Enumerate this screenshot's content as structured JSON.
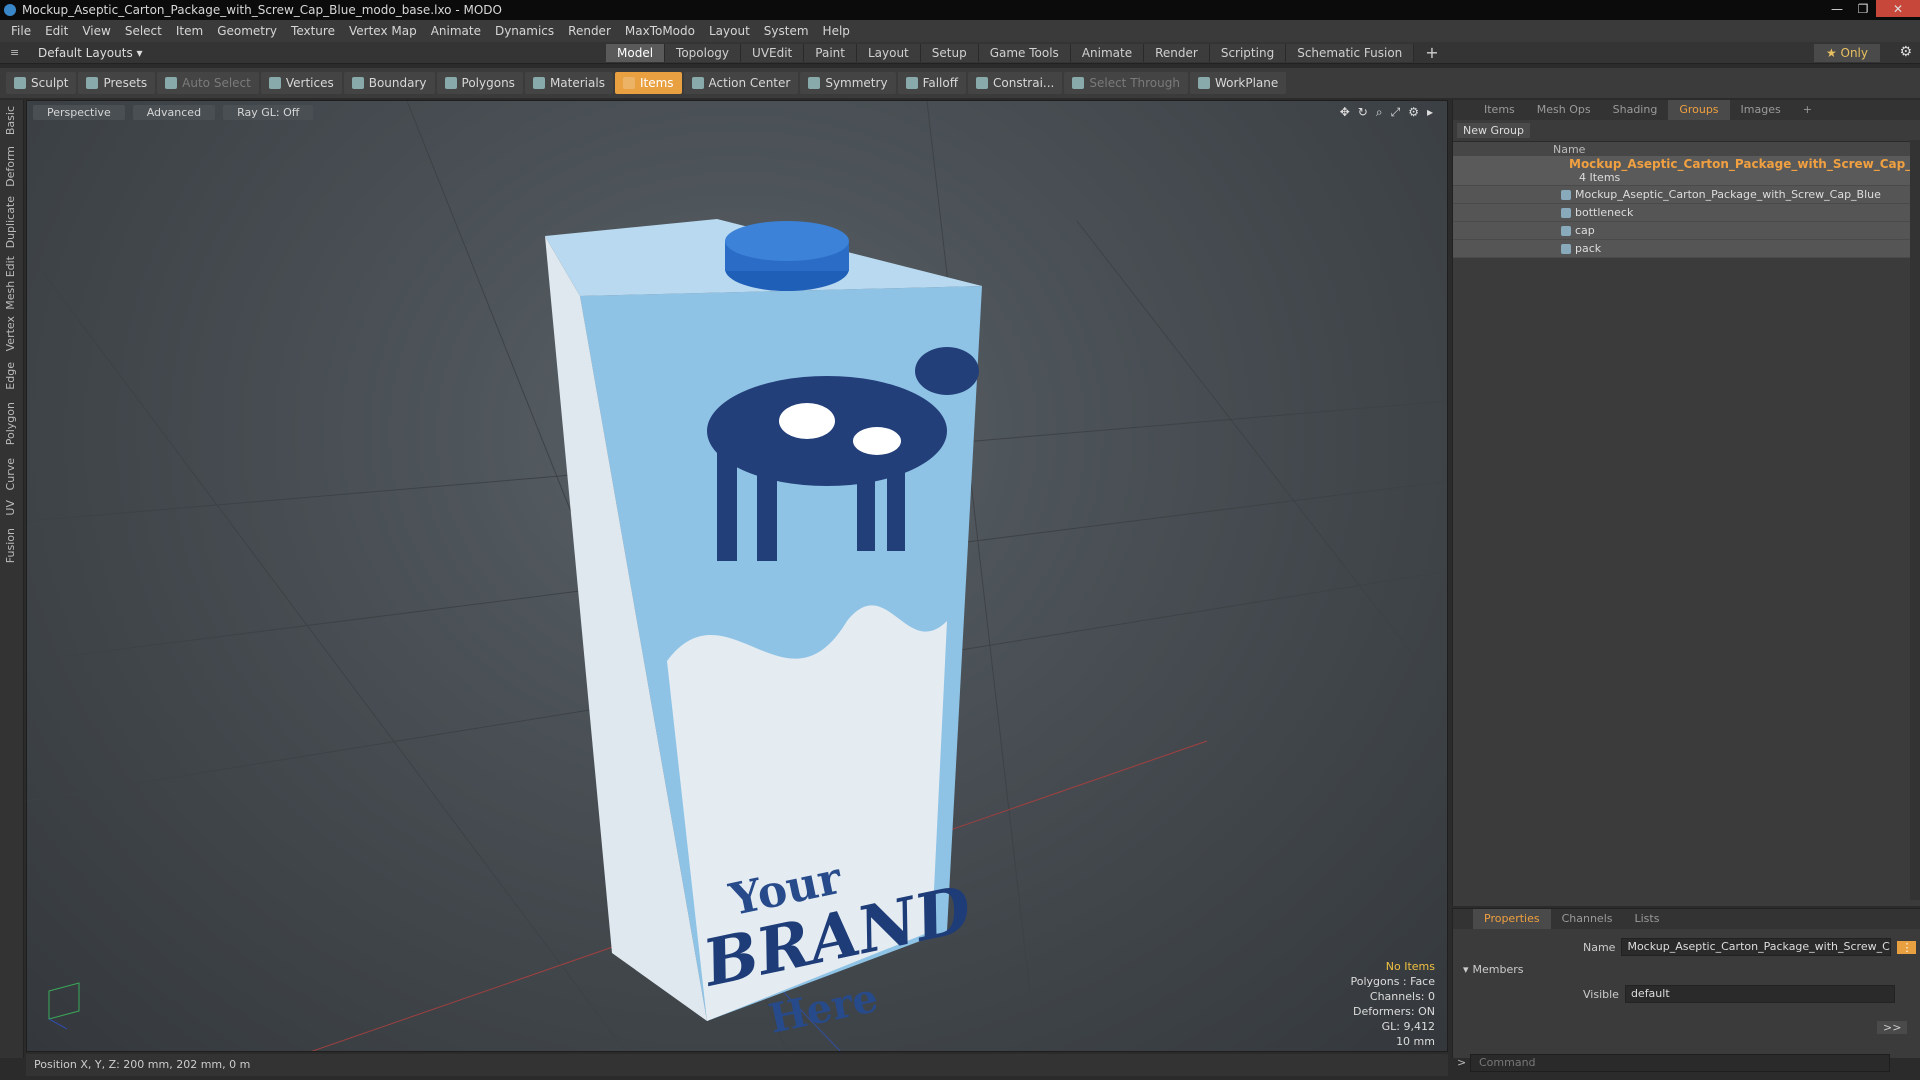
{
  "window": {
    "title": "Mockup_Aseptic_Carton_Package_with_Screw_Cap_Blue_modo_base.lxo - MODO"
  },
  "menu": [
    "File",
    "Edit",
    "View",
    "Select",
    "Item",
    "Geometry",
    "Texture",
    "Vertex Map",
    "Animate",
    "Dynamics",
    "Render",
    "MaxToModo",
    "Layout",
    "System",
    "Help"
  ],
  "layout": {
    "dropdown": "Default Layouts ▾"
  },
  "modetabs": [
    "Model",
    "Topology",
    "UVEdit",
    "Paint",
    "Layout",
    "Setup",
    "Game Tools",
    "Animate",
    "Render",
    "Scripting",
    "Schematic Fusion"
  ],
  "only_label": "★ Only",
  "toolbar": {
    "sculpt": "Sculpt",
    "presets": "Presets",
    "auto_select": "Auto Select",
    "vertices": "Vertices",
    "boundary": "Boundary",
    "polygons": "Polygons",
    "materials": "Materials",
    "items": "Items",
    "action_center": "Action Center",
    "symmetry": "Symmetry",
    "falloff": "Falloff",
    "constrain": "Constrai...",
    "select_through": "Select Through",
    "workplane": "WorkPlane"
  },
  "left_tabs": [
    "Basic",
    "Deform",
    "Duplicate",
    "Mesh Edit",
    "Vertex",
    "Edge",
    "Polygon",
    "Curve",
    "UV",
    "Fusion"
  ],
  "viewport": {
    "view": "Perspective",
    "shading": "Advanced",
    "raygl": "Ray GL: Off",
    "stats": {
      "items": "No Items",
      "polygons": "Polygons : Face",
      "channels": "Channels: 0",
      "deformers": "Deformers: ON",
      "gl": "GL: 9,412",
      "scale": "10 mm"
    },
    "brand": {
      "line1": "Your",
      "line2": "BRAND",
      "line3": "Here"
    }
  },
  "status": {
    "position": "Position X, Y, Z:  200 mm, 202 mm, 0 m"
  },
  "rightpanel": {
    "tabs": [
      "Items",
      "Mesh Ops",
      "Shading",
      "Groups",
      "Images"
    ],
    "active_tab": "Groups",
    "new_group": "New Group",
    "col_name": "Name",
    "group": {
      "title": "Mockup_Aseptic_Carton_Package_with_Screw_Cap_B...",
      "count": "4 Items"
    },
    "items": [
      "Mockup_Aseptic_Carton_Package_with_Screw_Cap_Blue",
      "bottleneck",
      "cap",
      "pack"
    ]
  },
  "props": {
    "tabs": [
      "Properties",
      "Channels",
      "Lists"
    ],
    "name_label": "Name",
    "name_value": "Mockup_Aseptic_Carton_Package_with_Screw_Cap_B",
    "members": "Members",
    "visible_label": "Visible",
    "visible_value": "default"
  },
  "command_placeholder": "Command"
}
